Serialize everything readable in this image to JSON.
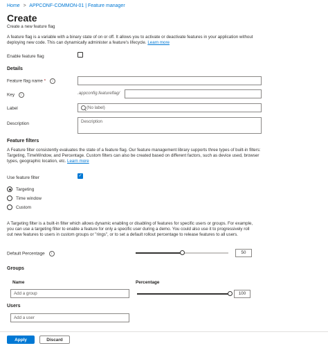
{
  "breadcrumb": {
    "home": "Home",
    "resource": "APPCONF-COMMON-01 | Feature manager",
    "separator": ">"
  },
  "header": {
    "title": "Create",
    "subtitle": "Create a new feature flag"
  },
  "intro": {
    "text": "A feature flag is a variable with a binary state of on or off. It allows you to activate or deactivate features in your application without deploying new code. This can dynamically administer a feature's lifecycle.",
    "link": "Learn more"
  },
  "enable": {
    "label": "Enable feature flag",
    "checked": false
  },
  "details": {
    "heading": "Details",
    "name_label": "Feature flag name",
    "required_mark": "*",
    "key_label": "Key",
    "key_prefix": ".appconfig.featureflag/",
    "label_label": "Label",
    "label_placeholder": "(No label)",
    "description_label": "Description",
    "description_placeholder": "Description"
  },
  "filters": {
    "heading": "Feature filters",
    "text": "A Feature filter consistently evaluates the state of a feature flag. Our feature management library supports three types of built-in filters: Targeting, TimeWindow, and Percentage. Custom filters can also be created based on different factors, such as device used, browser types, geographic location, etc.",
    "link": "Learn more",
    "use_label": "Use feature filter",
    "use_checked": true,
    "options": [
      "Targeting",
      "Time window",
      "Custom"
    ],
    "selected": "Targeting"
  },
  "targeting": {
    "text": "A Targeting filter is a built-in filter which allows dynamic enabling or disabling of features for specific users or groups. For example, you can use a targeting filter to enable a feature for only a specific user during a demo. You could also use it to progressively roll out new features to users in custom groups or \"rings\", or to set a default rollout percentage to release features to all users.",
    "default_label": "Default Percentage",
    "default_value": "50",
    "default_fraction": 0.5,
    "groups_heading": "Groups",
    "col_name": "Name",
    "col_percentage": "Percentage",
    "group_placeholder": "Add a group",
    "group_value": "100",
    "group_fraction": 1.0,
    "users_heading": "Users",
    "user_placeholder": "Add a user"
  },
  "footer": {
    "apply": "Apply",
    "discard": "Discard"
  },
  "colors": {
    "accent": "#0078d4",
    "text": "#323130",
    "border": "#8a8886"
  }
}
